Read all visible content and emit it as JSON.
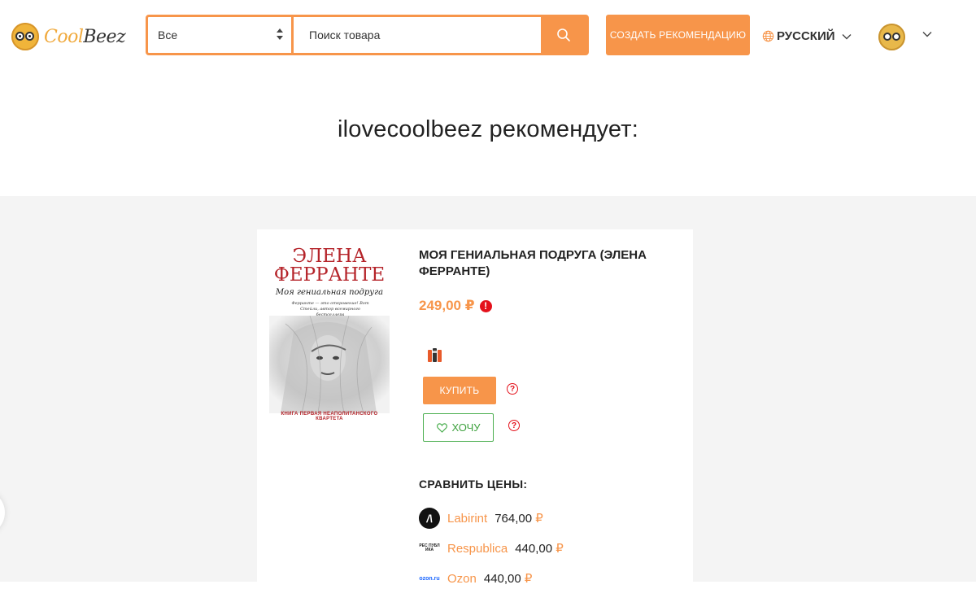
{
  "header": {
    "logo": {
      "part1": "Cool",
      "part2": "Beez"
    },
    "search": {
      "category_selected": "Все",
      "placeholder": "Поиск товара",
      "value": ""
    },
    "create_button_label": "СОЗДАТЬ РЕКОМЕНДАЦИЮ",
    "language_label": "РУССКИЙ"
  },
  "page": {
    "title": "ilovecoolbeez рекомендует:"
  },
  "product": {
    "cover": {
      "author_line1": "ЭЛЕНА",
      "author_line2": "ФЕРРАНТЕ",
      "subtitle": "Моя гениальная подруга",
      "quote": "Ферранте — это откровение! Вот Стейли, автор всемирного бестселлера",
      "footer": "КНИГА ПЕРВАЯ НЕАПОЛИТАНСКОГО КВАРТЕТА"
    },
    "title": "МОЯ ГЕНИАЛЬНАЯ ПОДРУГА (ЭЛЕНА ФЕРРАНТЕ)",
    "price": "249,00 ₽",
    "buy_label": "КУПИТЬ",
    "want_label": "ХОЧУ",
    "help_symbol": "?",
    "alert_symbol": "!"
  },
  "compare": {
    "title": "СРАВНИТЬ ЦЕНЫ:",
    "shops": [
      {
        "name": "Labirint",
        "price": "764,00",
        "currency": "₽",
        "logo_text": "/\\"
      },
      {
        "name": "Respublica",
        "price": "440,00",
        "currency": "₽",
        "logo_text": "РЕС ПУБЛ ИКА"
      },
      {
        "name": "Ozon",
        "price": "440,00",
        "currency": "₽",
        "logo_text": "ozon.ru"
      }
    ]
  },
  "colors": {
    "accent": "#f7954a",
    "alert": "#e4111b",
    "want_green": "#4caf50",
    "content_bg": "#f4f4f4"
  },
  "icons": [
    "search-icon",
    "globe-icon",
    "chevron-down-icon",
    "alert-icon",
    "help-icon",
    "heart-icon",
    "select-arrows-icon"
  ]
}
